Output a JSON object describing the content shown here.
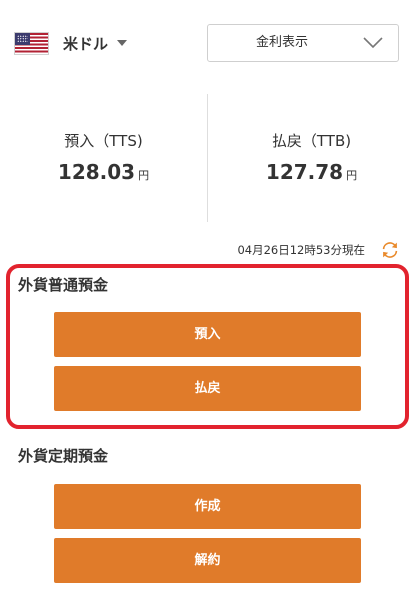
{
  "header": {
    "currency": {
      "flag_icon": "us-flag-icon",
      "label": "米ドル",
      "caret_icon": "caret-down-icon"
    },
    "rate_select": {
      "selected": "金利表示",
      "icon": "chevron-down-icon"
    }
  },
  "rates": {
    "deposit": {
      "title": "預入（TTS)",
      "value": "128.03",
      "unit": "円"
    },
    "withdraw": {
      "title": "払戻（TTB)",
      "value": "127.78",
      "unit": "円"
    }
  },
  "timestamp": {
    "text": "04月26日12時53分現在",
    "icon": "refresh-icon"
  },
  "ordinary_deposit": {
    "title": "外貨普通預金",
    "buttons": [
      "預入",
      "払戻"
    ]
  },
  "time_deposit": {
    "title": "外貨定期預金",
    "buttons": [
      "作成",
      "解約"
    ]
  },
  "colors": {
    "accent": "#e07b2a",
    "highlight": "#e2232e",
    "refresh_orange": "#e98a2b"
  }
}
